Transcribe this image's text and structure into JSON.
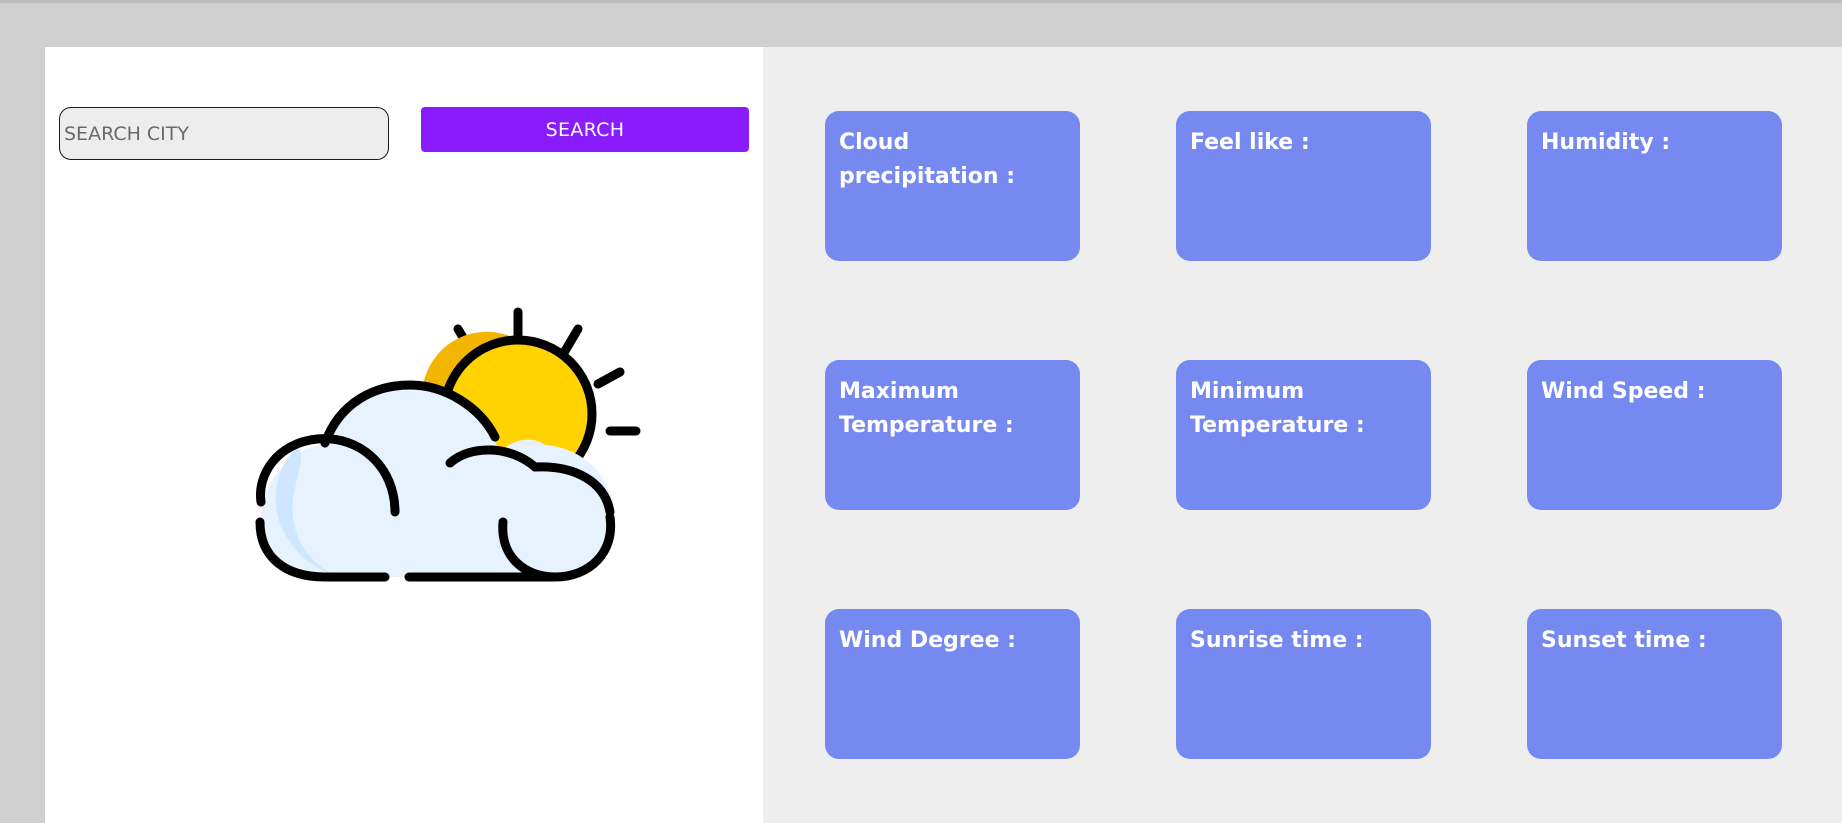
{
  "search": {
    "placeholder": "SEARCH CITY",
    "value": "",
    "button_label": "SEARCH"
  },
  "weather_icon": {
    "name": "partly-cloudy-icon"
  },
  "cards": [
    {
      "label": "Cloud precipitation :"
    },
    {
      "label": "Feel like :"
    },
    {
      "label": "Humidity :"
    },
    {
      "label": "Maximum Temperature :"
    },
    {
      "label": "Minimum Temperature :"
    },
    {
      "label": "Wind Speed :"
    },
    {
      "label": "Wind Degree :"
    },
    {
      "label": "Sunrise time :"
    },
    {
      "label": "Sunset time :"
    }
  ],
  "colors": {
    "accent": "#8a1bfc",
    "card": "#7689f0",
    "sun": "#ffd200",
    "cloud": "#e6f3ff"
  }
}
